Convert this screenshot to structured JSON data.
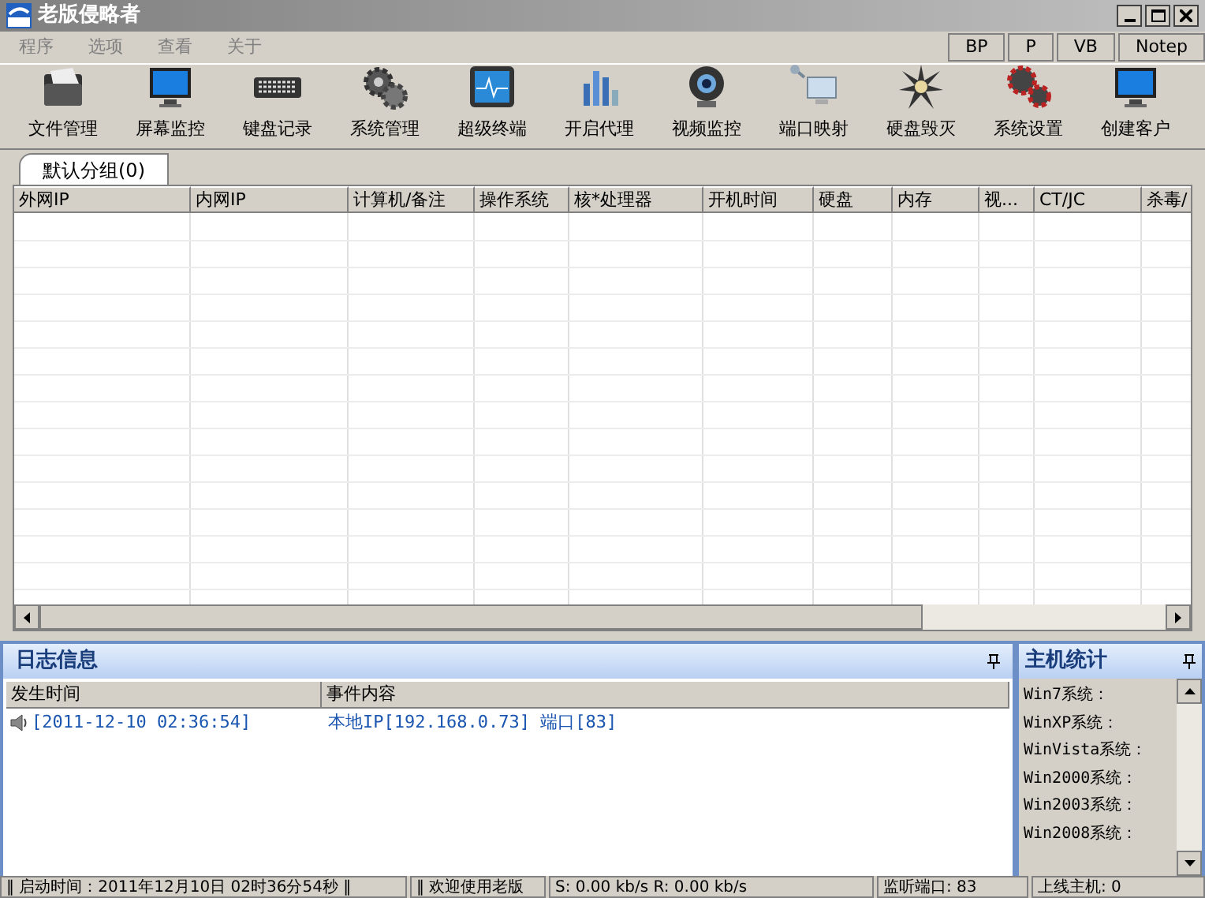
{
  "window": {
    "title": "老版侵略者"
  },
  "menu": [
    "程序",
    "选项",
    "查看",
    "关于"
  ],
  "quick_buttons": [
    "BP",
    "P",
    "VB",
    "Notep"
  ],
  "toolbar": [
    {
      "label": "文件管理",
      "kind": "folder"
    },
    {
      "label": "屏幕监控",
      "kind": "monitor"
    },
    {
      "label": "键盘记录",
      "kind": "keyboard"
    },
    {
      "label": "系统管理",
      "kind": "gears"
    },
    {
      "label": "超级终端",
      "kind": "terminal"
    },
    {
      "label": "开启代理",
      "kind": "bars"
    },
    {
      "label": "视频监控",
      "kind": "webcam"
    },
    {
      "label": "端口映射",
      "kind": "network"
    },
    {
      "label": "硬盘毁灭",
      "kind": "burst"
    },
    {
      "label": "系统设置",
      "kind": "redgears"
    },
    {
      "label": "创建客户",
      "kind": "monitor"
    }
  ],
  "tabs": [
    {
      "label": "默认分组(0)",
      "selected": true
    }
  ],
  "table": {
    "columns": [
      "外网IP",
      "内网IP",
      "计算机/备注",
      "操作系统",
      "核*处理器",
      "开机时间",
      "硬盘",
      "内存",
      "视...",
      "CT/JC",
      "杀毒/"
    ]
  },
  "log_panel": {
    "title": "日志信息",
    "columns": [
      "发生时间",
      "事件内容"
    ],
    "rows": [
      {
        "time": "[2011-12-10 02:36:54]",
        "event": "本地IP[192.168.0.73] 端口[83]"
      }
    ]
  },
  "stats_panel": {
    "title": "主机统计",
    "items": [
      "Win7系统：",
      "WinXP系统：",
      "WinVista系统：",
      "Win2000系统：",
      "Win2003系统：",
      "Win2008系统："
    ]
  },
  "status_bar": [
    "‖ 启动时间：2011年12月10日 02时36分54秒 ‖",
    "‖ 欢迎使用老版",
    "S: 0.00 kb/s R: 0.00 kb/s",
    "监听端口: 83",
    "上线主机: 0"
  ]
}
